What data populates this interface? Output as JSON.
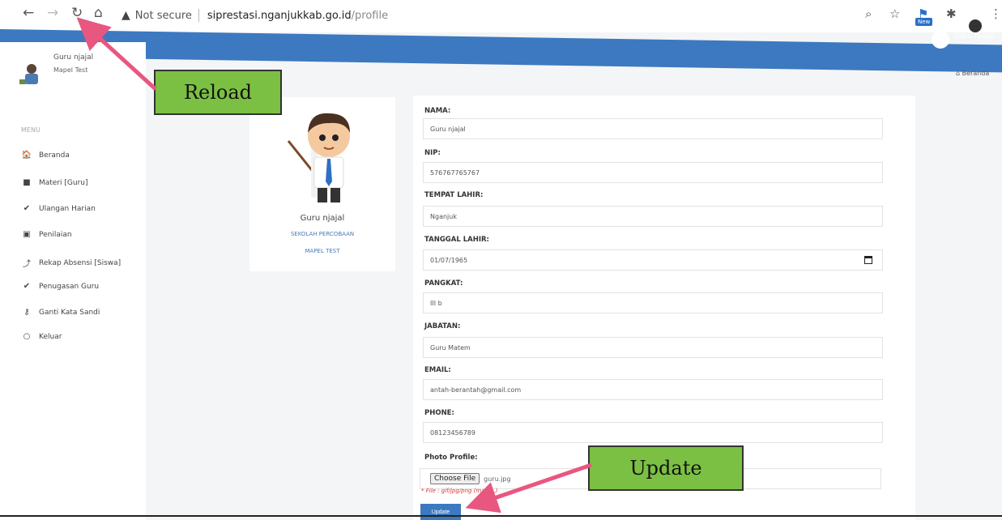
{
  "browser": {
    "back_icon": "←",
    "forward_icon": "→",
    "reload_icon": "↻",
    "home_icon": "⌂",
    "warning_icon": "▲",
    "not_secure": "Not secure",
    "url_host": "siprestasi.nganjukkab.go.id",
    "url_path": "/profile",
    "new_badge": "New"
  },
  "topbar": {
    "user": "Guru njajal"
  },
  "sidebar": {
    "user_name": "Guru njajal",
    "user_mapel": "Mapel Test",
    "menu_label": "MENU",
    "items": [
      {
        "label": "Beranda",
        "icon": "🏠"
      },
      {
        "label": "Materi [Guru]",
        "icon": "■"
      },
      {
        "label": "Ulangan Harian",
        "icon": "✔"
      },
      {
        "label": "Penilaian",
        "icon": "▣"
      },
      {
        "label": "Rekap Absensi [Siswa]",
        "icon": "⤴"
      },
      {
        "label": "Penugasan Guru",
        "icon": "✔"
      },
      {
        "label": "Ganti Kata Sandi",
        "icon": "⚷"
      },
      {
        "label": "Keluar",
        "icon": "○"
      }
    ]
  },
  "breadcrumb": "Beranda",
  "profile_card": {
    "name": "Guru njajal",
    "school": "SEKOLAH PERCOBAAN",
    "mapel": "MAPEL TEST"
  },
  "form": {
    "nama_label": "NAMA:",
    "nama_value": "Guru njajal",
    "nip_label": "NIP:",
    "nip_value": "576767765767",
    "tempat_label": "TEMPAT LAHIR:",
    "tempat_value": "Nganjuk",
    "tanggal_label": "TANGGAL LAHIR:",
    "tanggal_value": "01/07/1965",
    "pangkat_label": "PANGKAT:",
    "pangkat_value": "III b",
    "jabatan_label": "JABATAN:",
    "jabatan_value": "Guru Matem",
    "email_label": "EMAIL:",
    "email_value": "antah-berantah@gmail.com",
    "phone_label": "PHONE:",
    "phone_value": "08123456789",
    "photo_label": "Photo Profile:",
    "choose_file": "Choose File",
    "file_name": "guru.jpg",
    "file_hint": "* File : gif/jpg/png (max ...)",
    "update_label": "Update"
  },
  "annotations": {
    "reload": "Reload",
    "update": "Update"
  },
  "colors": {
    "accent": "#3c79c0",
    "annotation_bg": "#7bc043",
    "arrow": "#e8577f"
  }
}
